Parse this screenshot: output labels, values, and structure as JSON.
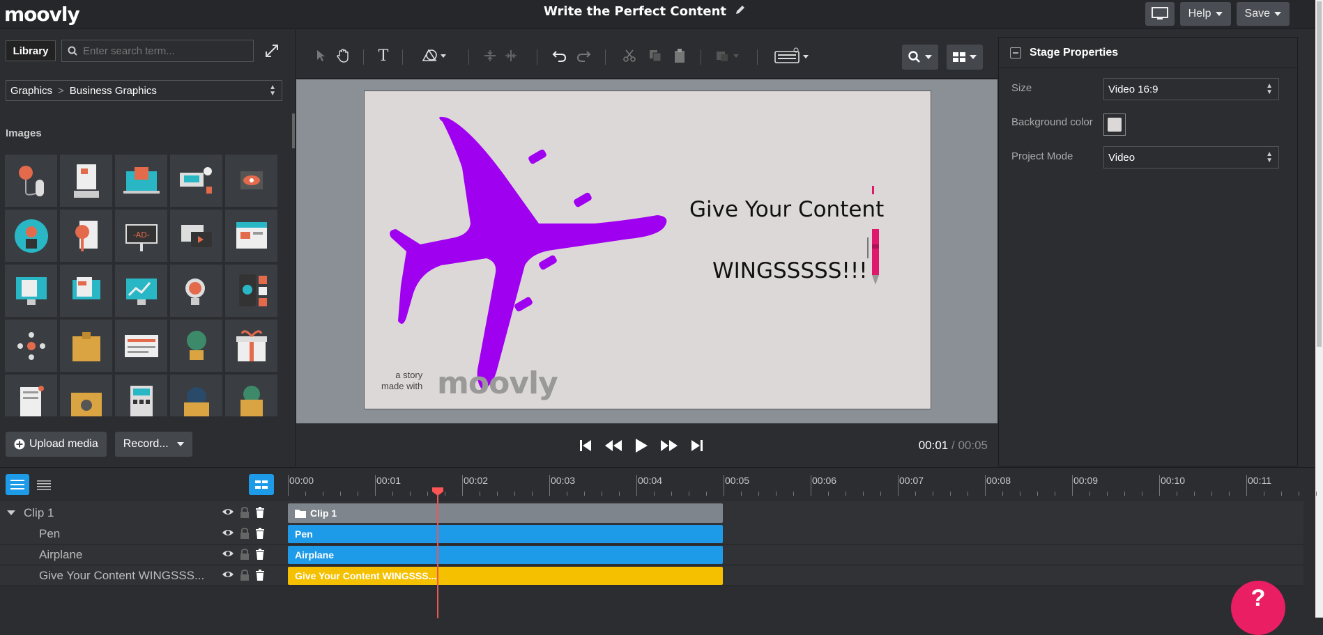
{
  "app": {
    "logo": "moovly",
    "title": "Write the Perfect Content"
  },
  "top_right": {
    "help_label": "Help",
    "save_label": "Save"
  },
  "library": {
    "tab_label": "Library",
    "search_placeholder": "Enter search term...",
    "breadcrumb": {
      "parent": "Graphics",
      "current": "Business Graphics"
    },
    "section_title": "Images",
    "upload_label": "Upload media",
    "record_label": "Record..."
  },
  "canvas": {
    "line1": "Give Your Content",
    "line2": "WINGSSSSS!!!",
    "watermark_text_1": "a story",
    "watermark_text_2": "made with",
    "watermark_logo": "moovly",
    "background_color": "#ddd8d8",
    "airplane_color": "#a000f0",
    "pen_color": "#e0186c"
  },
  "player": {
    "current_time": "00:01",
    "separator": "/",
    "total_time": "00:05"
  },
  "properties": {
    "title": "Stage Properties",
    "size_label": "Size",
    "size_value": "Video 16:9",
    "bg_label": "Background color",
    "mode_label": "Project Mode",
    "mode_value": "Video"
  },
  "timeline": {
    "ticks": [
      "00:00",
      "00:01",
      "00:02",
      "00:03",
      "00:04",
      "00:05",
      "00:06",
      "00:07",
      "00:08",
      "00:09",
      "00:10",
      "00:11"
    ],
    "layers": [
      {
        "name": "Clip 1",
        "bar_label": "Clip 1",
        "bar_color": "#7f858c"
      },
      {
        "name": "Pen",
        "bar_label": "Pen",
        "bar_color": "#1e9be8"
      },
      {
        "name": "Airplane",
        "bar_label": "Airplane",
        "bar_color": "#1e9be8"
      },
      {
        "name": "Give Your Content WINGSSS...",
        "bar_label": "Give Your Content WINGSSS...",
        "bar_color": "#f5c000"
      }
    ]
  },
  "help_fab": "?"
}
